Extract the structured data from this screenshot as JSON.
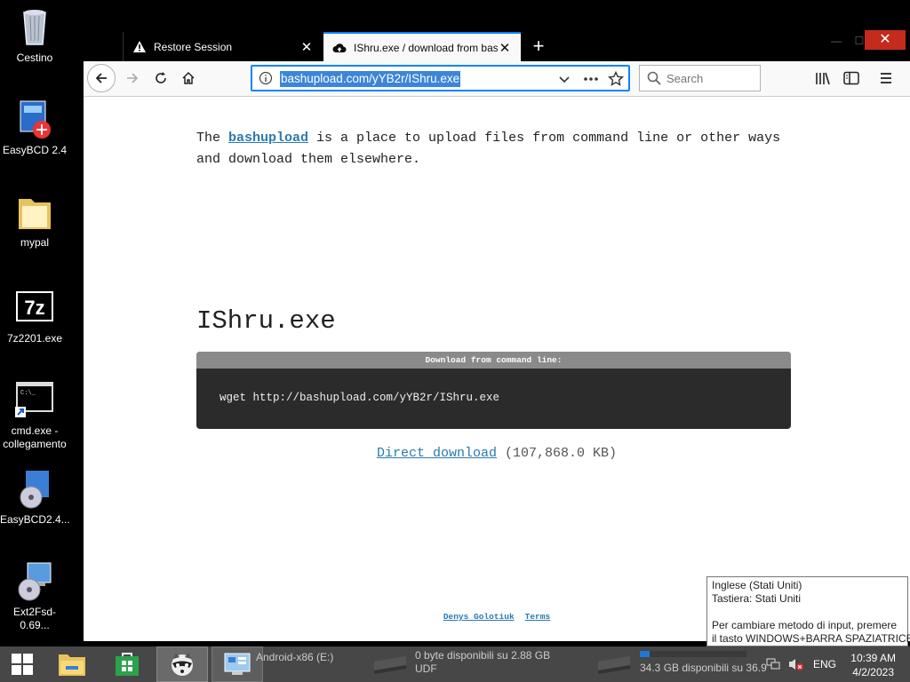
{
  "desktop": {
    "icons": [
      {
        "label": "Cestino"
      },
      {
        "label": "EasyBCD 2.4"
      },
      {
        "label": "mypal"
      },
      {
        "label": "7z2201.exe"
      },
      {
        "label": "cmd.exe - collegamento"
      },
      {
        "label": "EasyBCD2.4..."
      },
      {
        "label": "Ext2Fsd-0.69..."
      }
    ]
  },
  "browser": {
    "tabs": [
      {
        "title": "Restore Session",
        "icon": "warning-icon"
      },
      {
        "title": "IShru.exe / download from bas",
        "icon": "upload-cloud-icon"
      }
    ],
    "url": "bashupload.com/yYB2r/IShru.exe",
    "search_placeholder": "Search"
  },
  "page": {
    "intro_pre": "The ",
    "intro_link": "bashupload",
    "intro_post": " is a place to upload files from command line or other ways and download them elsewhere.",
    "filename": "IShru.exe",
    "cmd_header": "Download from command line:",
    "cmd": "wget http://bashupload.com/yYB2r/IShru.exe",
    "direct_download": "Direct download",
    "size": " (107,868.0 KB)",
    "footer_author": "Denys Golotiuk",
    "footer_terms": "Terms"
  },
  "tooltip": {
    "line1": "Inglese (Stati Uniti)",
    "line2": "Tastiera: Stati Uniti",
    "line3": "Per cambiare metodo di input, premere",
    "line4": "il tasto WINDOWS+BARRA SPAZIATRICE."
  },
  "taskbar": {
    "drive1": "Android-x86 (E:)",
    "drive2_line1": "0 byte disponibili su 2.88 GB",
    "drive2_line2": "UDF",
    "drive3": "34.3 GB disponibili su 36.9",
    "lang": "ENG",
    "time": "10:39 AM",
    "date": "4/2/2023"
  },
  "colors": {
    "accent": "#0a84ff",
    "link": "#2a7ab0",
    "close": "#c42b1c"
  }
}
